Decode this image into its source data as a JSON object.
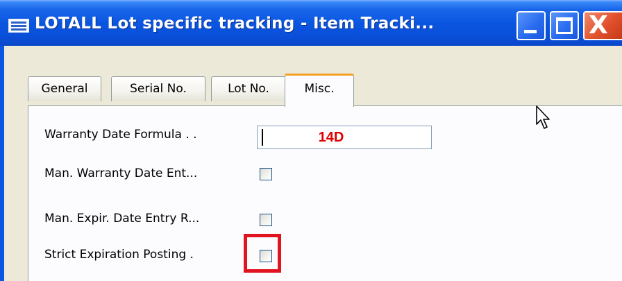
{
  "window": {
    "title": "LOTALL Lot specific tracking - Item Tracki...",
    "icon": "table-form-icon",
    "controls": {
      "minimize_icon": "minimize-icon",
      "maximize_icon": "maximize-icon",
      "close_icon": "close-icon",
      "close_glyph": "X"
    }
  },
  "tabs": [
    {
      "label": "General",
      "active": false
    },
    {
      "label": "Serial No.",
      "active": false
    },
    {
      "label": "Lot No.",
      "active": false
    },
    {
      "label": "Misc.",
      "active": true
    }
  ],
  "fields": {
    "warranty_date_formula": {
      "label": "Warranty Date Formula . .",
      "value": "14D"
    },
    "man_warranty_date_entry": {
      "label": "Man. Warranty Date Ent...",
      "checked": false
    },
    "man_expir_date_entry": {
      "label": "Man. Expir. Date Entry R...",
      "checked": false
    },
    "strict_expiration_posting": {
      "label": "Strict Expiration Posting .",
      "checked": false,
      "highlighted": true
    }
  },
  "colors": {
    "titlebar": "#0a55e0",
    "tab_active_accent": "#f3a024",
    "annotation_value": "#e00000",
    "highlight_border": "#e0131e"
  }
}
